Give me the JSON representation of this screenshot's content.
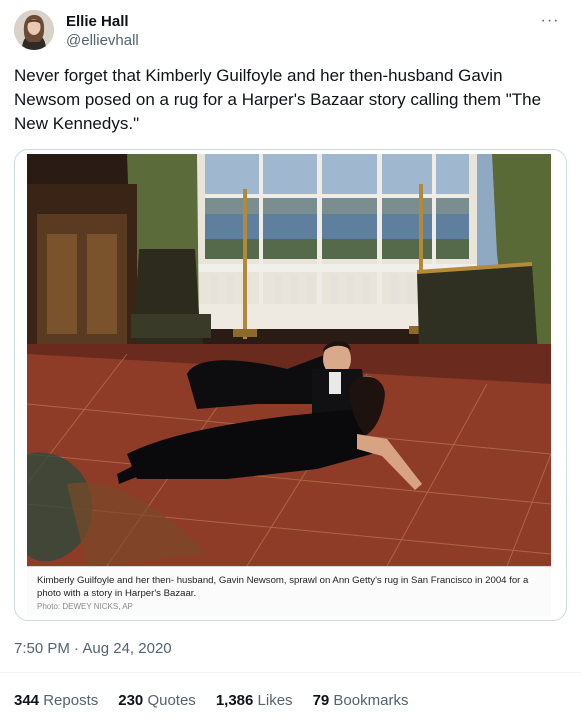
{
  "author": {
    "display_name": "Ellie Hall",
    "handle": "@ellievhall"
  },
  "more_icon": "more-horizontal-icon",
  "tweet_text": "Never forget that Kimberly Guilfoyle and her then-husband Gavin Newsom posed on a rug for a Harper's Bazaar story calling them \"The New Kennedys.\"",
  "media": {
    "caption": "Kimberly Guilfoyle and her then- husband, Gavin Newsom, sprawl on Ann Getty's rug in San Francisco in 2004 for a photo with a story in Harper's Bazaar.",
    "credit": "Photo: DEWEY NICKS, AP"
  },
  "timestamp": {
    "time": "7:50 PM",
    "separator": " · ",
    "date": "Aug 24, 2020"
  },
  "stats": [
    {
      "count": "344",
      "label": "Reposts"
    },
    {
      "count": "230",
      "label": "Quotes"
    },
    {
      "count": "1,386",
      "label": "Likes"
    },
    {
      "count": "79",
      "label": "Bookmarks"
    }
  ],
  "colors": {
    "text_primary": "#0f1419",
    "text_secondary": "#536471",
    "border": "#cfd9de"
  }
}
